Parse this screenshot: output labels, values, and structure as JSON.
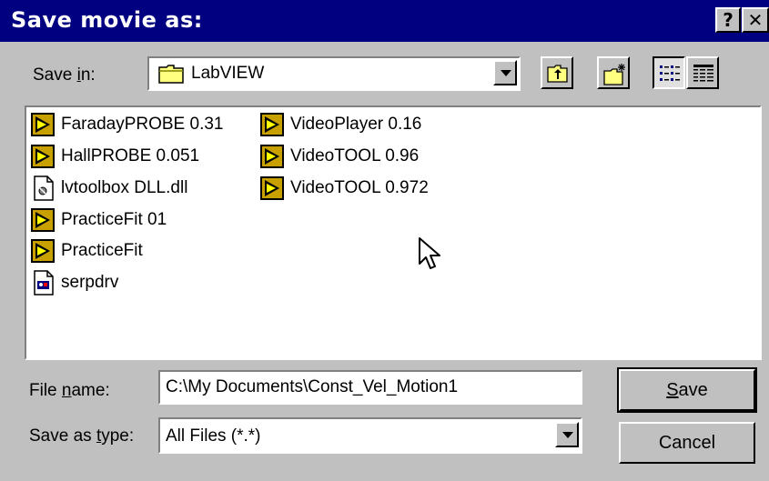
{
  "window": {
    "title": "Save movie as:",
    "help_label": "?",
    "close_label": "✕"
  },
  "save_in": {
    "label_pre": "Save ",
    "label_key": "i",
    "label_post": "n:",
    "current_folder": "LabVIEW"
  },
  "toolbar": {
    "buttons": [
      "up-one-level",
      "create-new-folder",
      "list-view",
      "details-view"
    ]
  },
  "files": [
    {
      "name": "FaradayPROBE 0.31",
      "icon": "labview-vi-icon"
    },
    {
      "name": "HallPROBE 0.051",
      "icon": "labview-vi-icon"
    },
    {
      "name": "lvtoolbox DLL.dll",
      "icon": "dll-file-icon"
    },
    {
      "name": "PracticeFit 01",
      "icon": "labview-vi-icon"
    },
    {
      "name": "PracticeFit",
      "icon": "labview-vi-icon"
    },
    {
      "name": "serpdrv",
      "icon": "driver-file-icon"
    },
    {
      "name": "VideoPlayer 0.16",
      "icon": "labview-vi-icon"
    },
    {
      "name": "VideoTOOL 0.96",
      "icon": "labview-vi-icon"
    },
    {
      "name": "VideoTOOL 0.972",
      "icon": "labview-vi-icon"
    }
  ],
  "file_name": {
    "label_pre": "File ",
    "label_key": "n",
    "label_post": "ame:",
    "value": "C:\\My Documents\\Const_Vel_Motion1"
  },
  "save_as_type": {
    "label_pre": "Save as ",
    "label_key": "t",
    "label_post": "ype:",
    "value": "All Files (*.*)"
  },
  "buttons": {
    "save_key": "S",
    "save_rest": "ave",
    "cancel": "Cancel"
  }
}
